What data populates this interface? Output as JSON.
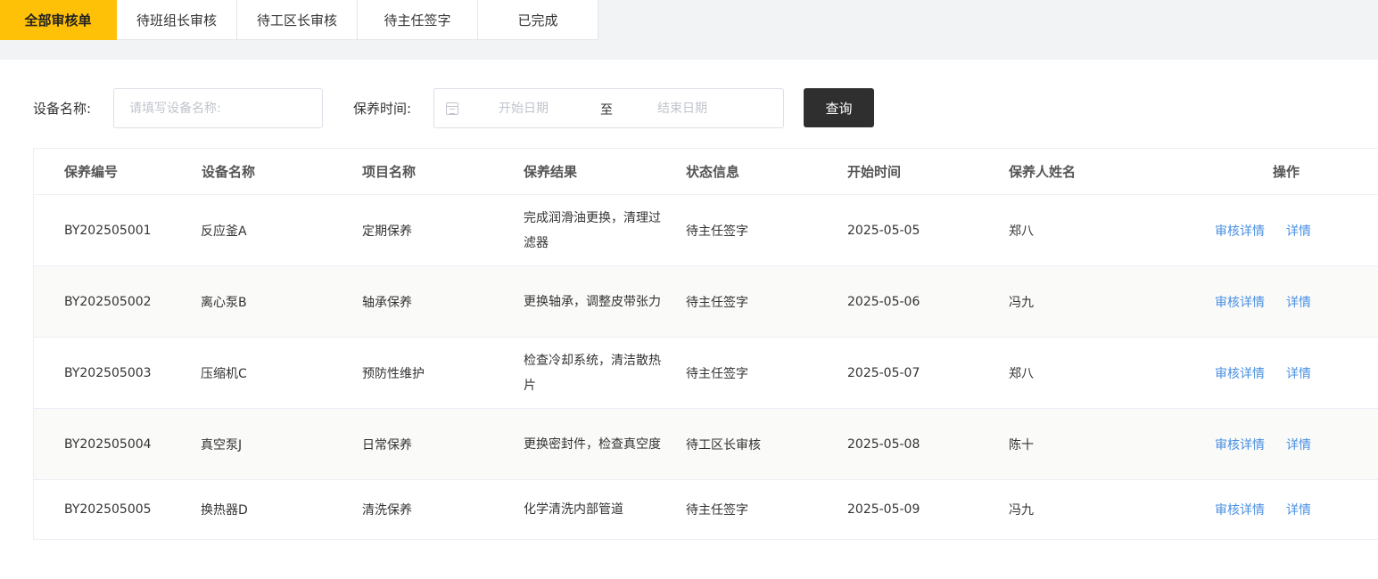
{
  "tabs": [
    "全部审核单",
    "待班组长审核",
    "待工区长审核",
    "待主任签字",
    "已完成"
  ],
  "active_tab": 0,
  "filters": {
    "device_label": "设备名称:",
    "device_placeholder": "请填写设备名称:",
    "time_label": "保养时间:",
    "start_placeholder": "开始日期",
    "separator": "至",
    "end_placeholder": "结束日期",
    "query_button": "查询"
  },
  "table": {
    "headers": [
      "保养编号",
      "设备名称",
      "项目名称",
      "保养结果",
      "状态信息",
      "开始时间",
      "保养人姓名",
      "操作"
    ],
    "rows": [
      {
        "id": "BY202505001",
        "device": "反应釜A",
        "project": "定期保养",
        "result": "完成润滑油更换，清理过滤器",
        "status": "待主任签字",
        "start": "2025-05-05",
        "person": "郑八"
      },
      {
        "id": "BY202505002",
        "device": "离心泵B",
        "project": "轴承保养",
        "result": "更换轴承，调整皮带张力",
        "status": "待主任签字",
        "start": "2025-05-06",
        "person": "冯九"
      },
      {
        "id": "BY202505003",
        "device": "压缩机C",
        "project": "预防性维护",
        "result": "检查冷却系统，清洁散热片",
        "status": "待主任签字",
        "start": "2025-05-07",
        "person": "郑八"
      },
      {
        "id": "BY202505004",
        "device": "真空泵J",
        "project": "日常保养",
        "result": "更换密封件，检查真空度",
        "status": "待工区长审核",
        "start": "2025-05-08",
        "person": "陈十"
      },
      {
        "id": "BY202505005",
        "device": "换热器D",
        "project": "清洗保养",
        "result": "化学清洗内部管道",
        "status": "待主任签字",
        "start": "2025-05-09",
        "person": "冯九"
      }
    ],
    "op_review": "审核详情",
    "op_detail": "详情"
  },
  "colors": {
    "active_tab": "#ffc107",
    "link": "#4a90e2",
    "query_button": "#2f2f2f"
  }
}
